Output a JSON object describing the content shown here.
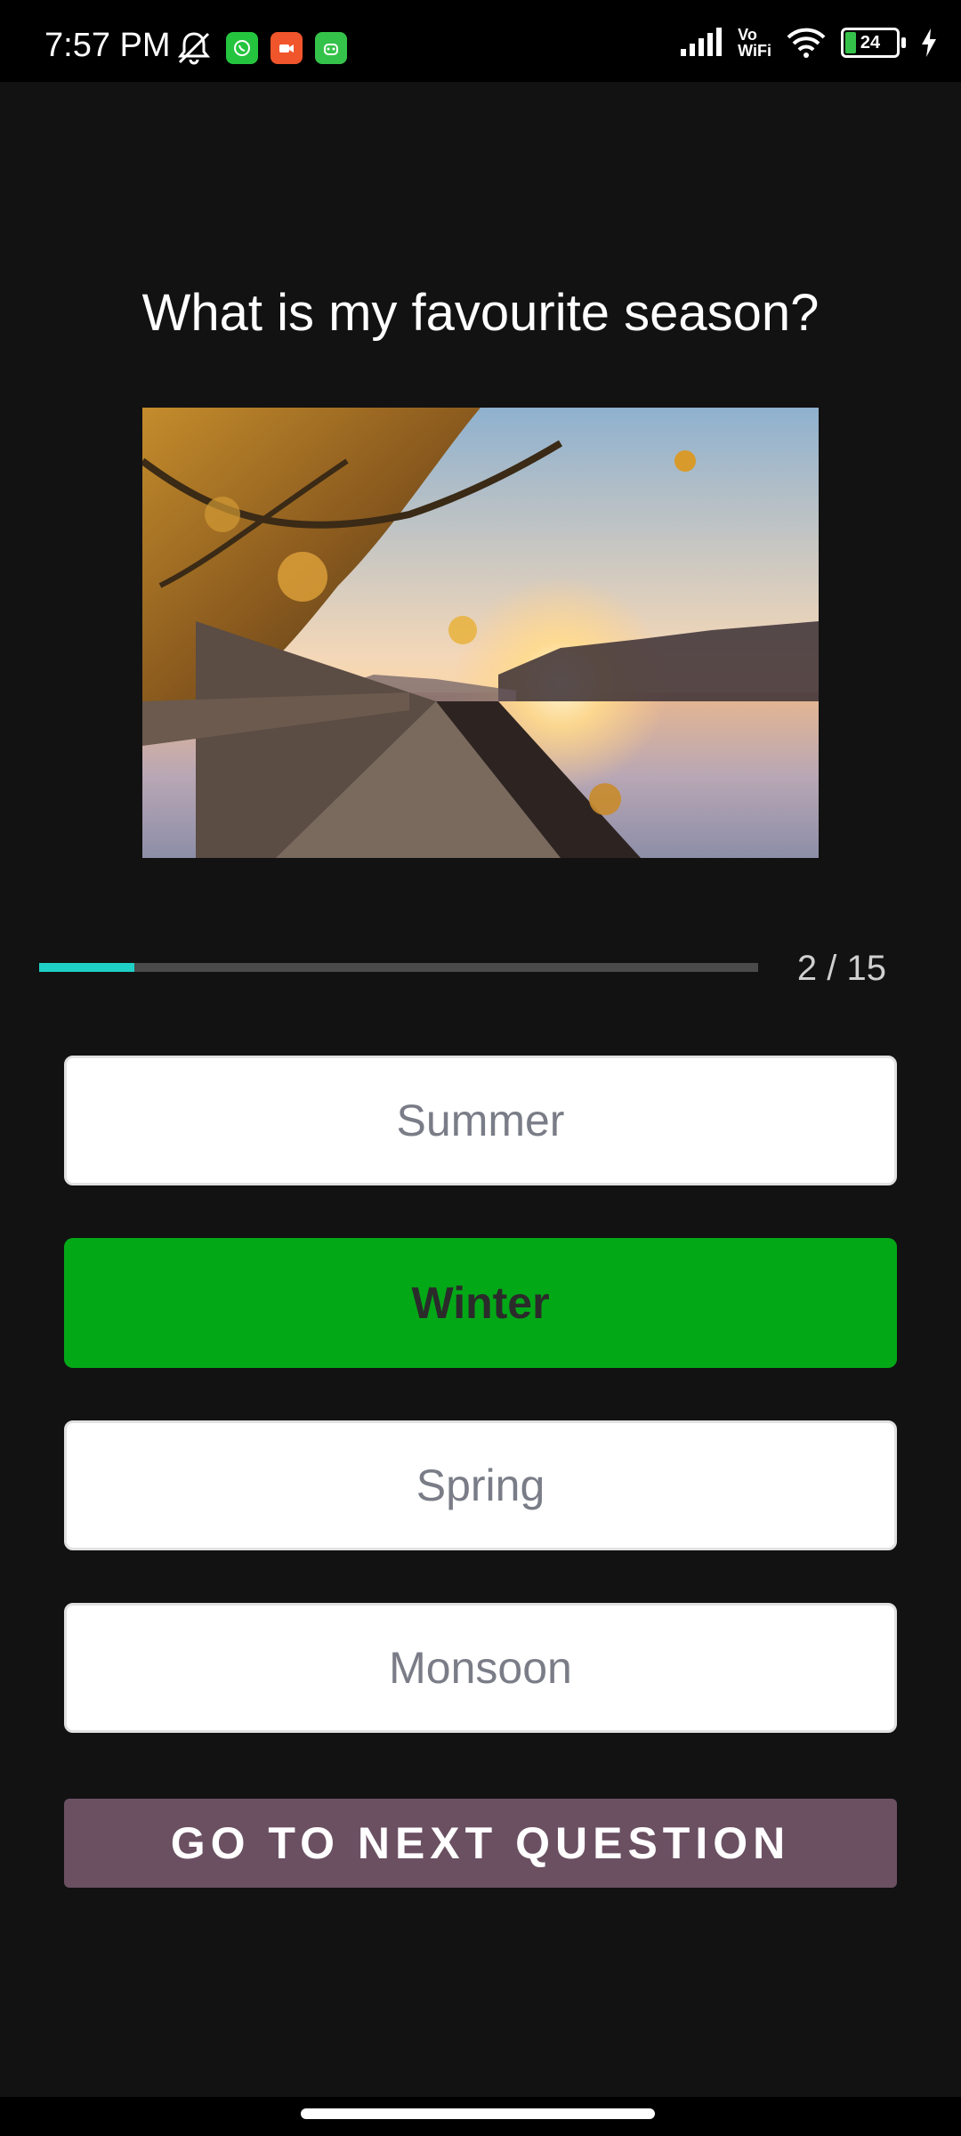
{
  "status_bar": {
    "time": "7:57 PM",
    "battery": "24",
    "vo_label": "Vo",
    "wifi_label": "WiFi",
    "icons": [
      "mute-icon",
      "whatsapp-icon",
      "video-app-icon",
      "android-app-icon",
      "signal-icon",
      "vowifi-icon",
      "wifi-icon",
      "battery-icon",
      "charging-icon"
    ]
  },
  "quiz": {
    "question": "What is my favourite season?",
    "progress_text": "2 / 15",
    "progress": 0.133,
    "options": [
      {
        "label": "Summer",
        "state": "default"
      },
      {
        "label": "Winter",
        "state": "correct"
      },
      {
        "label": "Spring",
        "state": "default"
      },
      {
        "label": "Monsoon",
        "state": "default"
      }
    ],
    "next_button": "GO TO NEXT QUESTION"
  },
  "colors": {
    "background": "#121212",
    "progress": "#1fd0c6",
    "correct": "#03a817",
    "next_button": "#6b5062"
  }
}
